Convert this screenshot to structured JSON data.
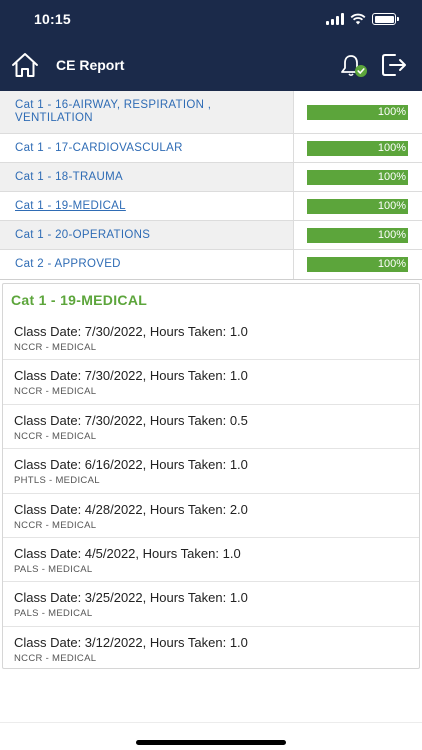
{
  "status_bar": {
    "time": "10:15"
  },
  "header": {
    "title": "CE Report"
  },
  "categories": [
    {
      "name": "Cat 1 - 16-AIRWAY, RESPIRATION , VENTILATION",
      "progress": 1.0,
      "progress_label": "100%"
    },
    {
      "name": "Cat 1 - 17-CARDIOVASCULAR",
      "progress": 1.0,
      "progress_label": "100%"
    },
    {
      "name": "Cat 1 - 18-TRAUMA",
      "progress": 1.0,
      "progress_label": "100%"
    },
    {
      "name": "Cat 1 - 19-MEDICAL",
      "progress": 1.0,
      "progress_label": "100%"
    },
    {
      "name": "Cat 1 - 20-OPERATIONS",
      "progress": 1.0,
      "progress_label": "100%"
    },
    {
      "name": "Cat 2 - APPROVED",
      "progress": 1.0,
      "progress_label": "100%"
    }
  ],
  "detail": {
    "title": "Cat 1 - 19-MEDICAL",
    "classes": [
      {
        "line": "Class Date: 7/30/2022, Hours Taken: 1.0",
        "org": "NCCR - MEDICAL"
      },
      {
        "line": "Class Date: 7/30/2022, Hours Taken: 1.0",
        "org": "NCCR - MEDICAL"
      },
      {
        "line": "Class Date: 7/30/2022, Hours Taken: 0.5",
        "org": "NCCR - MEDICAL"
      },
      {
        "line": "Class Date: 6/16/2022, Hours Taken: 1.0",
        "org": "PHTLS - MEDICAL"
      },
      {
        "line": "Class Date: 4/28/2022, Hours Taken: 2.0",
        "org": "NCCR - MEDICAL"
      },
      {
        "line": "Class Date: 4/5/2022, Hours Taken: 1.0",
        "org": "PALS - MEDICAL"
      },
      {
        "line": "Class Date: 3/25/2022, Hours Taken: 1.0",
        "org": "PALS - MEDICAL"
      },
      {
        "line": "Class Date: 3/12/2022, Hours Taken: 1.0",
        "org": "NCCR - MEDICAL"
      }
    ]
  },
  "colors": {
    "header_bg": "#1b2a4a",
    "link": "#2f6cb5",
    "progress_green": "#5ca53b",
    "title_green": "#5ca53b"
  },
  "icons": {
    "home": "home-icon",
    "bell": "bell-check-icon",
    "logout": "logout-icon"
  }
}
